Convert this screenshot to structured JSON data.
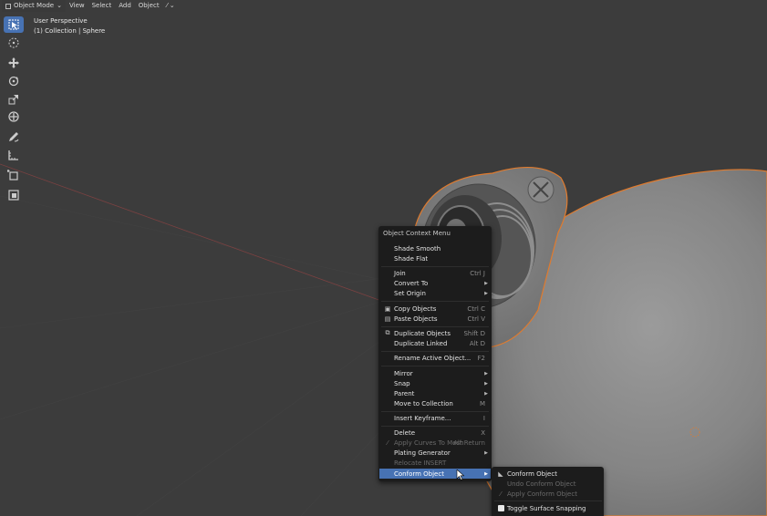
{
  "header": {
    "mode_label": "Object Mode",
    "menus": [
      "View",
      "Select",
      "Add",
      "Object"
    ]
  },
  "viewport": {
    "perspective_label": "User Perspective",
    "collection_label": "(1) Collection | Sphere"
  },
  "toolbar": {
    "tools": [
      "select-box-icon",
      "cursor-icon",
      "move-icon",
      "rotate-icon",
      "scale-icon",
      "transform-icon",
      "annotate-icon",
      "measure-icon",
      "add-cube-icon",
      "edit-icon"
    ]
  },
  "context_menu": {
    "title": "Object Context Menu",
    "items": [
      {
        "label": "Shade Smooth",
        "shortcut": ""
      },
      {
        "label": "Shade Flat",
        "shortcut": ""
      },
      {
        "label": "Join",
        "shortcut": "Ctrl J"
      },
      {
        "label": "Convert To",
        "shortcut": ""
      },
      {
        "label": "Set Origin",
        "shortcut": ""
      },
      {
        "label": "Copy Objects",
        "shortcut": "Ctrl C"
      },
      {
        "label": "Paste Objects",
        "shortcut": "Ctrl V"
      },
      {
        "label": "Duplicate Objects",
        "shortcut": "Shift D"
      },
      {
        "label": "Duplicate Linked",
        "shortcut": "Alt D"
      },
      {
        "label": "Rename Active Object...",
        "shortcut": "F2"
      },
      {
        "label": "Mirror",
        "shortcut": ""
      },
      {
        "label": "Snap",
        "shortcut": ""
      },
      {
        "label": "Parent",
        "shortcut": ""
      },
      {
        "label": "Move to Collection",
        "shortcut": "M"
      },
      {
        "label": "Insert Keyframe...",
        "shortcut": "I"
      },
      {
        "label": "Delete",
        "shortcut": "X"
      },
      {
        "label": "Apply Curves To Mesh",
        "shortcut": "Alt Return"
      },
      {
        "label": "Plating Generator",
        "shortcut": ""
      },
      {
        "label": "Relocate INSERT",
        "shortcut": ""
      },
      {
        "label": "Conform Object",
        "shortcut": ""
      }
    ]
  },
  "submenu": {
    "items": [
      {
        "label": "Conform Object"
      },
      {
        "label": "Undo Conform Object"
      },
      {
        "label": "Apply Conform Object"
      },
      {
        "label": "Toggle Surface Snapping"
      }
    ]
  },
  "colors": {
    "accent": "#4772b3",
    "background": "#3c3c3c",
    "menu_bg": "#1c1c1c",
    "outline": "#e07b2e"
  }
}
